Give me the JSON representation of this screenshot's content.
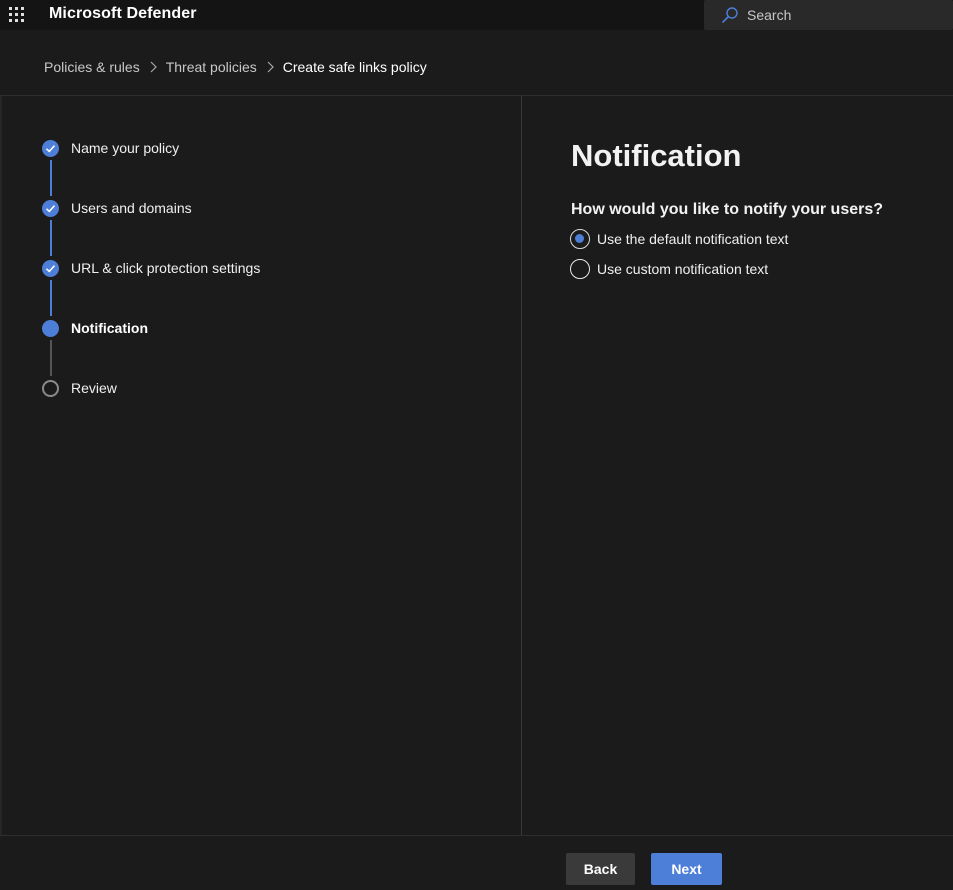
{
  "app": {
    "title": "Microsoft Defender",
    "search_placeholder": "Search"
  },
  "breadcrumb": {
    "items": [
      "Policies & rules",
      "Threat policies"
    ],
    "current": "Create safe links policy"
  },
  "wizard": {
    "steps": [
      {
        "label": "Name your policy",
        "status": "complete"
      },
      {
        "label": "Users and domains",
        "status": "complete"
      },
      {
        "label": "URL & click protection settings",
        "status": "complete"
      },
      {
        "label": "Notification",
        "status": "current"
      },
      {
        "label": "Review",
        "status": "pending"
      }
    ]
  },
  "content": {
    "title": "Notification",
    "question": "How would you like to notify your users?",
    "options": [
      {
        "label": "Use the default notification text",
        "selected": true
      },
      {
        "label": "Use custom notification text",
        "selected": false
      }
    ]
  },
  "footer": {
    "back_label": "Back",
    "next_label": "Next"
  },
  "colors": {
    "accent": "#4d7ed8",
    "background": "#1b1b1b",
    "topbar": "#141414"
  },
  "icons": {
    "app_launcher": "waffle-icon",
    "search": "search-icon",
    "breadcrumb_separator": "chevron-right-icon",
    "step_complete": "checkmark-icon"
  }
}
